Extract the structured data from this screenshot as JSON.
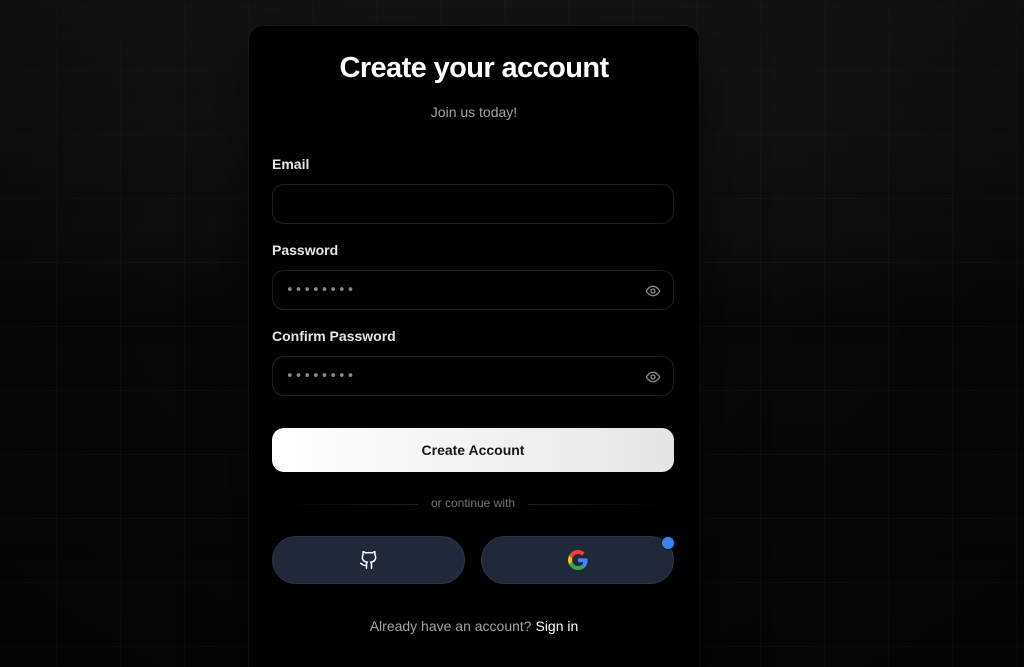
{
  "form": {
    "title": "Create your account",
    "subtitle": "Join us today!",
    "email": {
      "label": "Email",
      "value": "",
      "placeholder": ""
    },
    "password": {
      "label": "Password",
      "value": "••••••••",
      "toggle_icon": "eye-icon"
    },
    "confirm_password": {
      "label": "Confirm Password",
      "value": "••••••••",
      "toggle_icon": "eye-icon"
    },
    "submit_label": "Create Account",
    "divider_text": "or continue with",
    "social": [
      {
        "provider_icon": "github-icon"
      },
      {
        "provider_icon": "google-icon"
      }
    ],
    "signin_prompt": "Already have an account?",
    "signin_link": "Sign in"
  },
  "colors": {
    "card_background": "#000000",
    "social_button": "#1f2937",
    "notification_dot": "#3b82f6",
    "google_blue": "#4285F4",
    "google_red": "#EA4335",
    "google_yellow": "#FBBC05",
    "google_green": "#34A853"
  }
}
